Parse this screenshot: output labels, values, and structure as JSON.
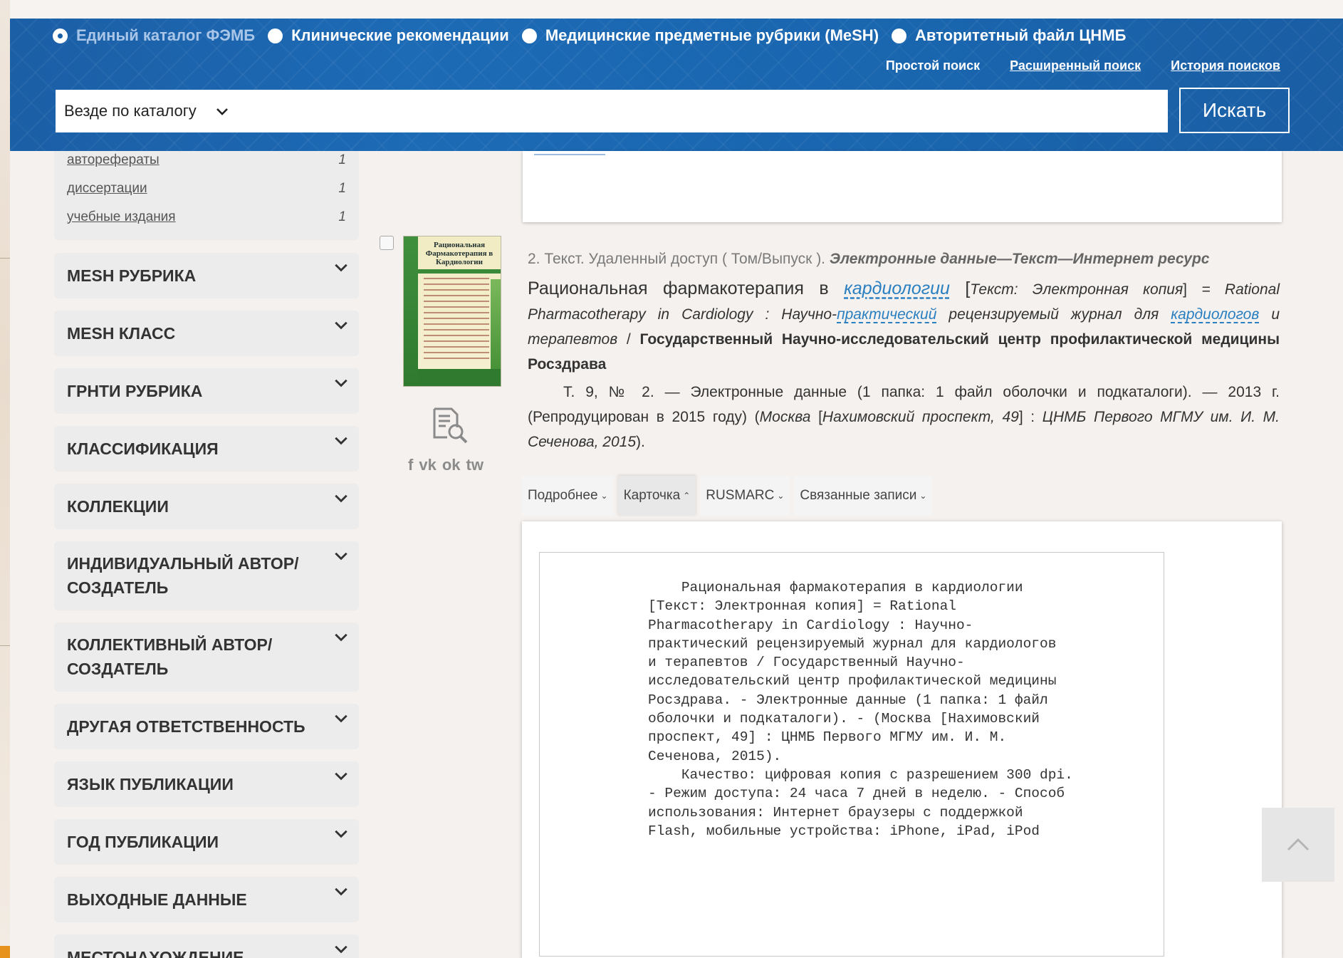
{
  "header": {
    "radios": [
      {
        "label": "Единый каталог ФЭМБ",
        "selected": true
      },
      {
        "label": "Клинические рекомендации",
        "selected": false
      },
      {
        "label": "Медицинские предметные рубрики (MeSH)",
        "selected": false
      },
      {
        "label": "Авторитетный файл ЦНМБ",
        "selected": false
      }
    ],
    "search_modes": {
      "simple": "Простой поиск",
      "extended": "Расширенный поиск",
      "history": "История поисков"
    },
    "scope": "Везде по каталогу",
    "search_placeholder": "",
    "search_button": "Искать",
    "colors": {
      "band": "#1b5fa6",
      "selected_radio_text": "#a9c6e8"
    }
  },
  "sidebar": {
    "types": [
      {
        "label": "авторефераты",
        "count": "1"
      },
      {
        "label": "диссертации",
        "count": "1"
      },
      {
        "label": "учебные издания",
        "count": "1"
      }
    ],
    "facets": [
      "MESH РУБРИКА",
      "MESH КЛАСС",
      "ГРНТИ РУБРИКА",
      "КЛАССИФИКАЦИЯ",
      "КОЛЛЕКЦИИ",
      "ИНДИВИДУАЛЬНЫЙ АВТОР/ СОЗДАТЕЛЬ",
      "КОЛЛЕКТИВНЫЙ АВТОР/ СОЗДАТЕЛЬ",
      "ДРУГАЯ ОТВЕТСТВЕННОСТЬ",
      "ЯЗЫК ПУБЛИКАЦИИ",
      "ГОД ПУБЛИКАЦИИ",
      "ВЫХОДНЫЕ ДАННЫЕ",
      "МЕСТОНАХОЖДЕНИЕ"
    ]
  },
  "record": {
    "header_plain": "2. Текст. Удаленный доступ ( Том/Выпуск ). ",
    "header_bold": "Электронные данные—Текст—Интернет ресурс",
    "title_a": "Рациональная фармакотерапия в ",
    "title_link": "кардиологии",
    "bracket_open": " [",
    "gmd": "Текст: Электронная копия",
    "bracket_close": "]",
    "parallel_a": " = Rational Pharmacotherapy in Cardiology : Научно-",
    "parallel_link1": "практический",
    "parallel_b": " рецензируемый журнал для ",
    "parallel_link2": "кардиологов",
    "parallel_c": " и терапевтов",
    "slash": " / ",
    "responsibility": "Государственный Научно-исследовательский центр профилактической медицины Росздрава",
    "issue": "Т. 9, № 2.",
    "extent": " — Электронные данные (1 папка: 1 файл оболочки и подкаталоги). — 2013 г. (Репродуцирован в 2015 году) (",
    "place_a": "Москва",
    "place_b": " [",
    "place_c": "Нахимовский проспект, 49",
    "place_d": "] : ",
    "publisher": "ЦНМБ Первого МГМУ им. И. М. Сеченова, 2015",
    "close_paren": ").",
    "cover_title": "Рациональная Фармакотерапия в Кардиологии",
    "social": [
      "f",
      "vk",
      "ok",
      "tw"
    ]
  },
  "tabs": [
    {
      "label": "Подробнее",
      "arrow": "⌄",
      "active": false
    },
    {
      "label": "Карточка",
      "arrow": "⌃",
      "active": true
    },
    {
      "label": "RUSMARC",
      "arrow": "⌄",
      "active": false
    },
    {
      "label": "Связанные записи",
      "arrow": "⌄",
      "active": false
    }
  ],
  "card_text": "    Рациональная фармакотерапия в кардиологии\n[Текст: Электронная копия] = Rational\nPharmacotherapy in Cardiology : Научно-\nпрактический рецензируемый журнал для кардиологов\nи терапевтов / Государственный Научно-\nисследовательский центр профилактической медицины\nРосздрава. - Электронные данные (1 папка: 1 файл\nоболочки и подкаталоги). - (Москва [Нахимовский\nпроспект, 49] : ЦНМБ Первого МГМУ им. И. М.\nСеченова, 2015).\n    Качество: цифровая копия с разрешением 300 dpi.\n- Режим доступа: 24 часа 7 дней в неделю. - Способ\nиспользования: Интернет браузеры с поддержкой\nFlash, мобильные устройства: iPhone, iPad, iPod"
}
